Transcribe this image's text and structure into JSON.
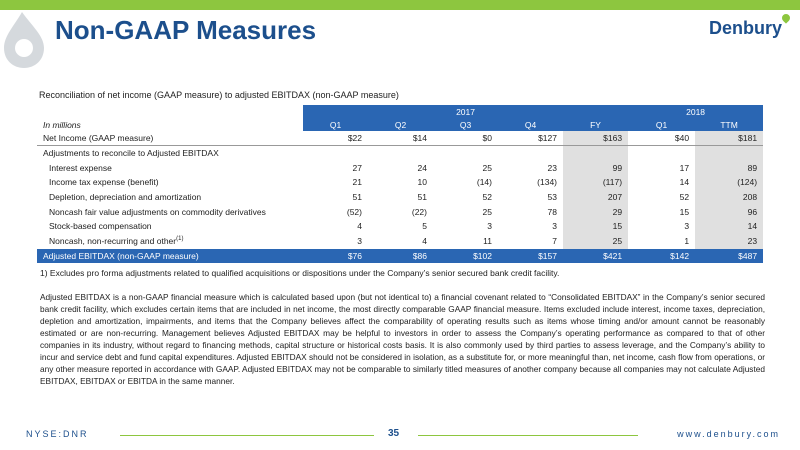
{
  "header": {
    "title": "Non-GAAP Measures",
    "logo": "Denbury"
  },
  "table": {
    "subtitle": "Reconciliation of net income (GAAP measure) to adjusted EBITDAX (non-GAAP measure)",
    "year_2017": "2017",
    "year_2018": "2018",
    "unit_label": "In millions",
    "columns": [
      "Q1",
      "Q2",
      "Q3",
      "Q4",
      "FY",
      "Q1",
      "TTM"
    ],
    "net_income": {
      "label": "Net Income (GAAP measure)",
      "values": [
        "$22",
        "$14",
        "$0",
        "$127",
        "$163",
        "$40",
        "$181"
      ]
    },
    "adjustments_label": "Adjustments to reconcile to Adjusted EBITDAX",
    "rows": [
      {
        "label": "Interest expense",
        "values": [
          "27",
          "24",
          "25",
          "23",
          "99",
          "17",
          "89"
        ]
      },
      {
        "label": "Income tax expense (benefit)",
        "values": [
          "21",
          "10",
          "(14)",
          "(134)",
          "(117)",
          "14",
          "(124)"
        ]
      },
      {
        "label": "Depletion, depreciation and amortization",
        "values": [
          "51",
          "51",
          "52",
          "53",
          "207",
          "52",
          "208"
        ]
      },
      {
        "label": "Noncash fair value adjustments on commodity derivatives",
        "values": [
          "(52)",
          "(22)",
          "25",
          "78",
          "29",
          "15",
          "96"
        ]
      },
      {
        "label": "Stock-based compensation",
        "values": [
          "4",
          "5",
          "3",
          "3",
          "15",
          "3",
          "14"
        ]
      },
      {
        "label": "Noncash, non-recurring and other",
        "footnote_mark": "(1)",
        "values": [
          "3",
          "4",
          "11",
          "7",
          "25",
          "1",
          "23"
        ]
      }
    ],
    "total": {
      "label": "Adjusted EBITDAX (non-GAAP measure)",
      "values": [
        "$76",
        "$86",
        "$102",
        "$157",
        "$421",
        "$142",
        "$487"
      ]
    }
  },
  "footnote": "1) Excludes pro forma adjustments related to qualified acquisitions or dispositions under the Company’s senior secured bank credit facility.",
  "paragraph": "Adjusted EBITDAX is a non-GAAP financial measure which is calculated based upon (but not identical to) a financial covenant related to “Consolidated EBITDAX” in the Company’s senior secured bank credit facility, which excludes certain items that are included in net income, the most directly comparable GAAP financial measure. Items excluded include interest, income taxes, depreciation, depletion and amortization, impairments, and items that the Company believes affect the comparability of operating results such as items whose timing and/or amount cannot be reasonably estimated or are non-recurring. Management believes Adjusted EBITDAX may be helpful to investors in order to assess the Company’s operating performance as compared to that of other companies in its industry, without regard to financing methods, capital structure or historical costs basis. It is also commonly used by third parties to assess leverage, and the Company’s ability to incur and service debt and fund capital expenditures. Adjusted EBITDAX should not be considered in isolation, as a substitute for, or more meaningful than, net income, cash flow from operations, or any other measure reported in accordance with GAAP. Adjusted EBITDAX may not be comparable to similarly titled measures of another company because all companies may not calculate Adjusted EBITDAX, EBITDAX or EBITDA in the same manner.",
  "footer": {
    "ticker": "NYSE:DNR",
    "page": "35",
    "url": "www.denbury.com"
  },
  "colors": {
    "blue": "#2a66b3",
    "navy": "#1c4f8c",
    "green": "#8dc63f",
    "shade": "#e0e0e0"
  }
}
